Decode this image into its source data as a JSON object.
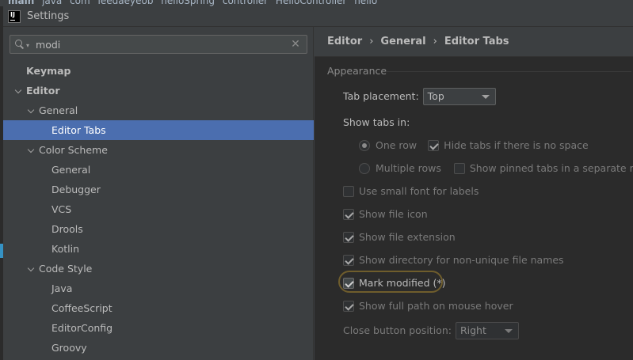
{
  "window": {
    "title": "Settings"
  },
  "background_crumbs": [
    "main",
    "java",
    "com",
    "leedaeyeob",
    "helloSpring",
    "controller",
    "HelloController",
    "hello"
  ],
  "search": {
    "value": "modi",
    "placeholder": ""
  },
  "tree": [
    {
      "label": "Keymap",
      "level": 0,
      "bold": true,
      "arrow": false,
      "selected": false
    },
    {
      "label": "Editor",
      "level": 0,
      "bold": true,
      "arrow": true,
      "selected": false
    },
    {
      "label": "General",
      "level": 1,
      "bold": false,
      "arrow": true,
      "selected": false
    },
    {
      "label": "Editor Tabs",
      "level": 2,
      "bold": false,
      "arrow": false,
      "selected": true
    },
    {
      "label": "Color Scheme",
      "level": 1,
      "bold": false,
      "arrow": true,
      "selected": false
    },
    {
      "label": "General",
      "level": 2,
      "bold": false,
      "arrow": false,
      "selected": false
    },
    {
      "label": "Debugger",
      "level": 2,
      "bold": false,
      "arrow": false,
      "selected": false
    },
    {
      "label": "VCS",
      "level": 2,
      "bold": false,
      "arrow": false,
      "selected": false
    },
    {
      "label": "Drools",
      "level": 2,
      "bold": false,
      "arrow": false,
      "selected": false
    },
    {
      "label": "Kotlin",
      "level": 2,
      "bold": false,
      "arrow": false,
      "selected": false
    },
    {
      "label": "Code Style",
      "level": 1,
      "bold": false,
      "arrow": true,
      "selected": false
    },
    {
      "label": "Java",
      "level": 2,
      "bold": false,
      "arrow": false,
      "selected": false
    },
    {
      "label": "CoffeeScript",
      "level": 2,
      "bold": false,
      "arrow": false,
      "selected": false
    },
    {
      "label": "EditorConfig",
      "level": 2,
      "bold": false,
      "arrow": false,
      "selected": false
    },
    {
      "label": "Groovy",
      "level": 2,
      "bold": false,
      "arrow": false,
      "selected": false
    }
  ],
  "breadcrumb": {
    "part1": "Editor",
    "part2": "General",
    "part3": "Editor Tabs"
  },
  "appearance": {
    "section_title": "Appearance",
    "tab_placement_label": "Tab placement:",
    "tab_placement_value": "Top",
    "show_tabs_in_label": "Show tabs in:",
    "one_row_label": "One row",
    "one_row_selected": true,
    "hide_tabs_label": "Hide tabs if there is no space",
    "hide_tabs_checked": true,
    "multiple_rows_label": "Multiple rows",
    "multiple_rows_selected": false,
    "show_pinned_label": "Show pinned tabs in a separate row",
    "show_pinned_checked": false,
    "small_font_label": "Use small font for labels",
    "small_font_checked": false,
    "file_icon_label": "Show file icon",
    "file_icon_checked": true,
    "file_ext_label": "Show file extension",
    "file_ext_checked": true,
    "dir_label": "Show directory for non-unique file names",
    "dir_checked": true,
    "mark_modified_label": "Mark modified (*)",
    "mark_modified_checked": true,
    "full_path_label": "Show full path on mouse hover",
    "full_path_checked": true,
    "close_button_label": "Close button position:",
    "close_button_value": "Right"
  },
  "colors": {
    "selection": "#4b6eaf",
    "panel": "#3c3f41",
    "content": "#2b2b2b",
    "highlight_ring": "#6f5d2c"
  }
}
